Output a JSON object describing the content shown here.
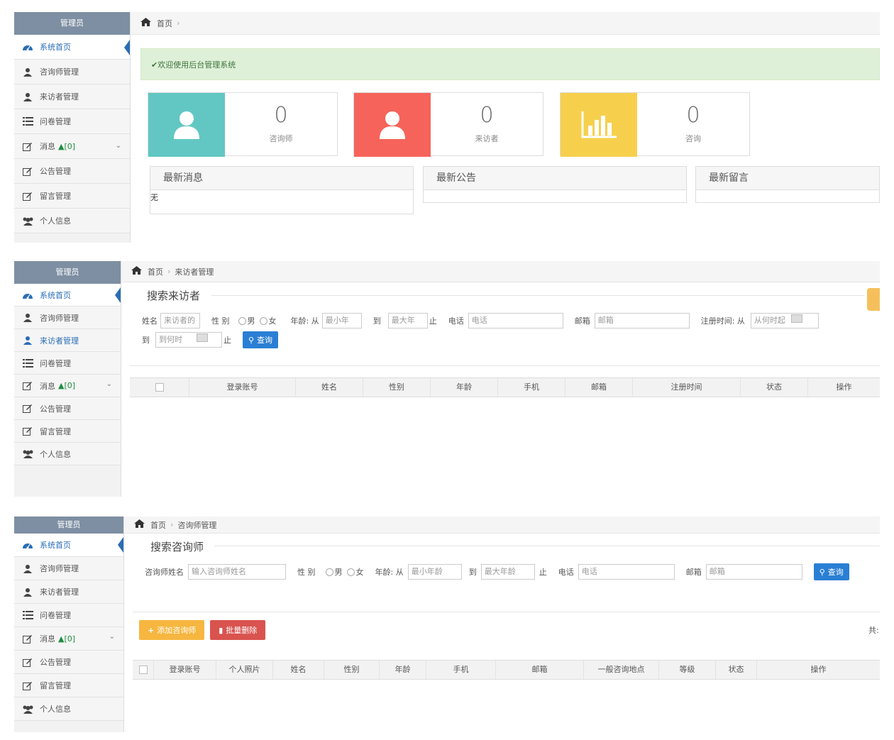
{
  "sidebar": {
    "header": "管理员",
    "items": [
      {
        "label": "系统首页"
      },
      {
        "label": "咨询师管理"
      },
      {
        "label": "来访者管理"
      },
      {
        "label": "问卷管理"
      },
      {
        "label": "消息",
        "badge": "[0]"
      },
      {
        "label": "公告管理"
      },
      {
        "label": "留言管理"
      },
      {
        "label": "个人信息"
      }
    ]
  },
  "dashboard": {
    "breadcrumb_home": "首页",
    "welcome_prefix": "✔欢迎使用",
    "welcome_strong": "后台管理系统",
    "stats": [
      {
        "value": "0",
        "label": "咨询师",
        "color": "#62c7c3"
      },
      {
        "value": "0",
        "label": "来访者",
        "color": "#f6635a"
      },
      {
        "value": "0",
        "label": "咨询",
        "color": "#f6d04d"
      }
    ],
    "boxes": [
      {
        "title": "最新消息",
        "content": "无"
      },
      {
        "title": "最新公告",
        "content": ""
      },
      {
        "title": "最新留言",
        "content": ""
      }
    ]
  },
  "visitor": {
    "breadcrumb_home": "首页",
    "breadcrumb_current": "来访者管理",
    "legend": "搜索来访者",
    "form": {
      "name_label": "姓名",
      "name_placeholder": "来访者的",
      "gender_label": "性 别",
      "male": "男",
      "female": "女",
      "age_label": "年龄: 从",
      "age_min": "最小年",
      "to": "到",
      "age_max": "最大年",
      "end": "止",
      "phone_label": "电话",
      "phone_placeholder": "电话",
      "email_label": "邮箱",
      "email_placeholder": "邮箱",
      "reg_label": "注册时间: 从",
      "reg_from": "从何时起",
      "reg_to_label": "到",
      "reg_to": "到何时",
      "reg_end": "止",
      "query": "查询"
    },
    "columns": [
      "登录账号",
      "姓名",
      "性别",
      "年龄",
      "手机",
      "邮箱",
      "注册时间",
      "状态",
      "操作"
    ]
  },
  "counselor": {
    "breadcrumb_home": "首页",
    "breadcrumb_current": "咨询师管理",
    "legend": "搜索咨询师",
    "form": {
      "name_label": "咨询师姓名",
      "name_placeholder": "输入咨询师姓名",
      "gender_label": "性 别",
      "male": "男",
      "female": "女",
      "age_label": "年龄: 从",
      "age_min": "最小年龄",
      "to": "到",
      "age_max": "最大年龄",
      "end": "止",
      "phone_label": "电话",
      "phone_placeholder": "电话",
      "email_label": "邮箱",
      "email_placeholder": "邮箱",
      "query": "查询"
    },
    "add_button": "添加咨询师",
    "batch_delete": "批量删除",
    "total_label": "共:",
    "columns": [
      "登录账号",
      "个人照片",
      "姓名",
      "性别",
      "年龄",
      "手机",
      "邮箱",
      "一般咨询地点",
      "等级",
      "状态",
      "操作"
    ]
  }
}
